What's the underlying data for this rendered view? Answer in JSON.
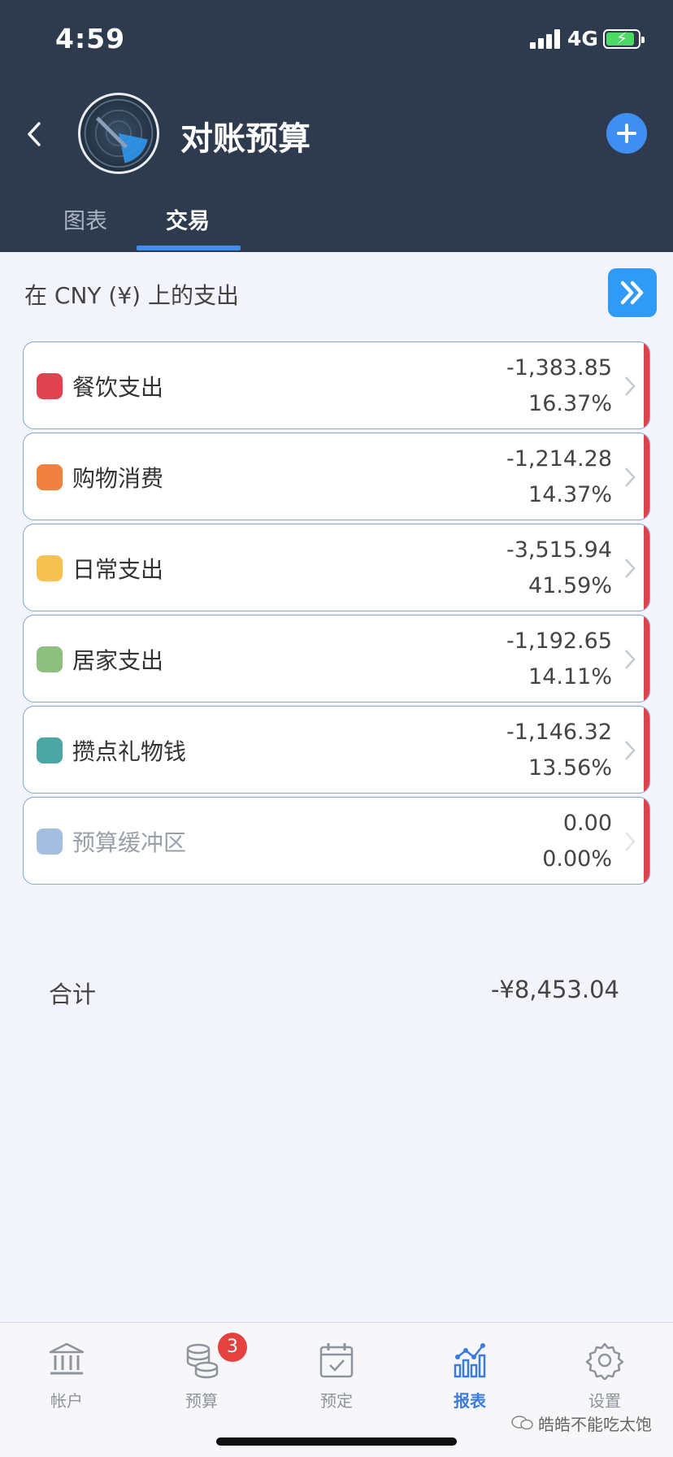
{
  "status_bar": {
    "time": "4:59",
    "network": "4G"
  },
  "header": {
    "title": "对账预算"
  },
  "tabs": [
    {
      "label": "图表"
    },
    {
      "label": "交易"
    }
  ],
  "section": {
    "title": "在 CNY (¥) 上的支出"
  },
  "rows": [
    {
      "label": "餐饮支出",
      "amount": "-1,383.85",
      "percent": "16.37%",
      "color": "#e0434f"
    },
    {
      "label": "购物消费",
      "amount": "-1,214.28",
      "percent": "14.37%",
      "color": "#f2803f"
    },
    {
      "label": "日常支出",
      "amount": "-3,515.94",
      "percent": "41.59%",
      "color": "#f7c150"
    },
    {
      "label": "居家支出",
      "amount": "-1,192.65",
      "percent": "14.11%",
      "color": "#8dc07f"
    },
    {
      "label": "攒点礼物钱",
      "amount": "-1,146.32",
      "percent": "13.56%",
      "color": "#4aa7a3"
    },
    {
      "label": "预算缓冲区",
      "amount": "0.00",
      "percent": "0.00%",
      "color": "#a5bde0"
    }
  ],
  "total": {
    "label": "合计",
    "value": "-¥8,453.04"
  },
  "tabbar": {
    "items": [
      {
        "label": "帐户",
        "icon": "bank-icon"
      },
      {
        "label": "预算",
        "icon": "coins-icon",
        "badge": "3"
      },
      {
        "label": "预定",
        "icon": "calendar-check-icon"
      },
      {
        "label": "报表",
        "icon": "chart-icon"
      },
      {
        "label": "设置",
        "icon": "gear-icon"
      }
    ],
    "active": "报表"
  },
  "watermark": {
    "text": "皓皓不能吃太饱"
  },
  "colors": {
    "header_bg": "#2e3b4f",
    "accent": "#3f8ff2",
    "row_bar": "#e0424a"
  }
}
